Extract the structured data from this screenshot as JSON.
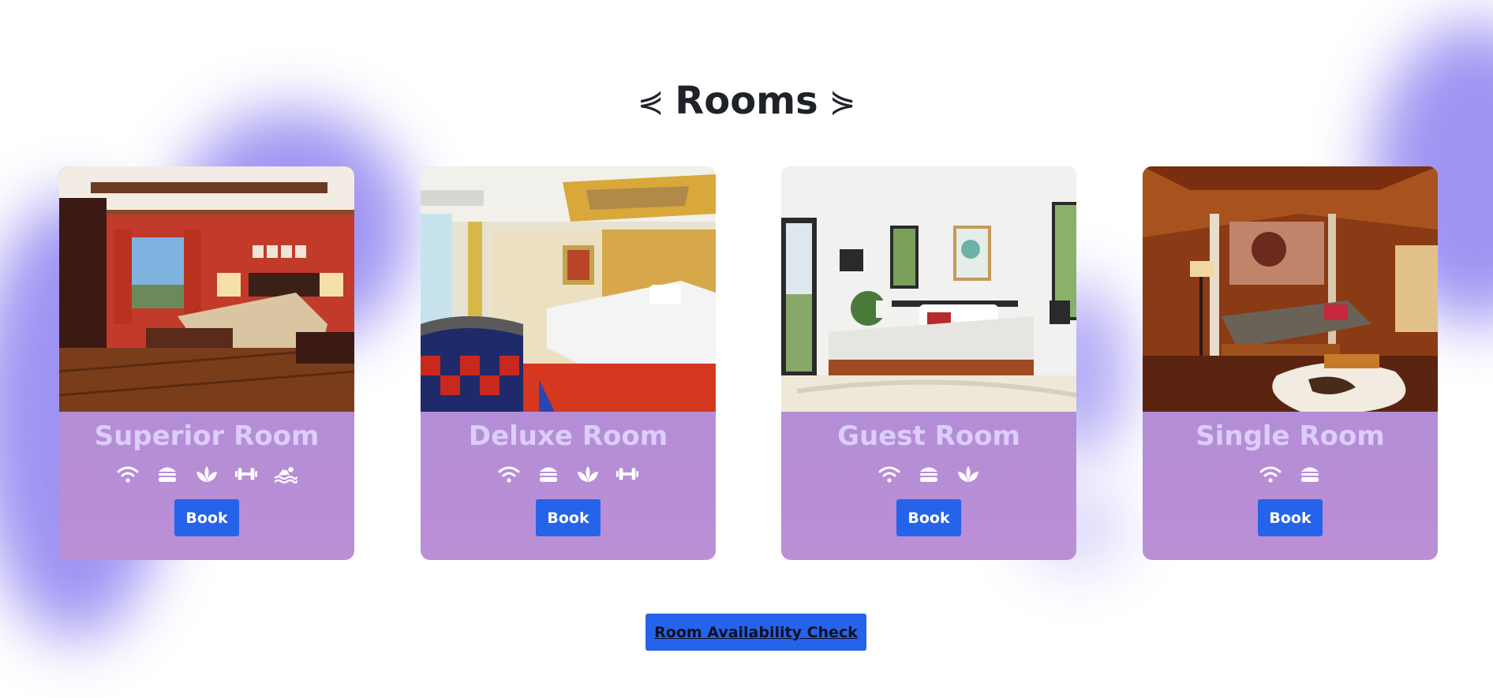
{
  "header": {
    "title": "Rooms",
    "left_ornament": "⋞",
    "right_ornament": "⋟"
  },
  "colors": {
    "accent": "#2563ea",
    "card_gradient_top": "#a88ad8",
    "card_gradient_bottom": "#bb8fd6",
    "room_name": "#dccdfb",
    "blob": "#7e70ee",
    "title": "#1f2229"
  },
  "rooms": [
    {
      "name": "Superior Room",
      "image": "photo of a red-walled bedroom with wooden floor and patterned bedspread",
      "amenities": [
        "wifi-icon",
        "burger-icon",
        "spa-icon",
        "dumbbell-icon",
        "swimmer-icon"
      ],
      "book_label": "Book"
    },
    {
      "name": "Deluxe Room",
      "image": "photo of a gold-trimmed bedroom with white bed and red carpet",
      "amenities": [
        "wifi-icon",
        "burger-icon",
        "spa-icon",
        "dumbbell-icon"
      ],
      "book_label": "Book"
    },
    {
      "name": "Guest Room",
      "image": "photo of a bright white bedroom with a bed, plant and shag rug",
      "amenities": [
        "wifi-icon",
        "burger-icon",
        "spa-icon"
      ],
      "book_label": "Book"
    },
    {
      "name": "Single Room",
      "image": "photo of an orange tent-style bedroom with canopy bed",
      "amenities": [
        "wifi-icon",
        "burger-icon"
      ],
      "book_label": "Book"
    }
  ],
  "availability": {
    "label": "Room Availability Check"
  }
}
